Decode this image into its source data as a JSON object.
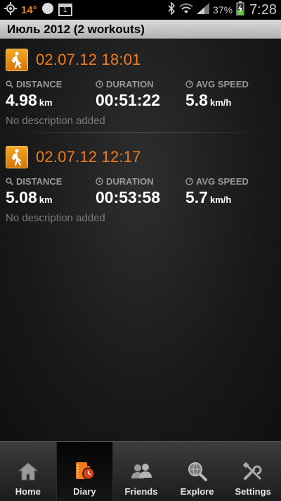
{
  "status_bar": {
    "temperature": "14°",
    "notification_count": "1",
    "battery_percent": "37%",
    "time": "7:28",
    "icons": [
      "gps-icon",
      "circle-icon",
      "calendar-icon",
      "bluetooth-icon",
      "wifi-icon",
      "signal-icon",
      "battery-charging-icon"
    ]
  },
  "header": {
    "title": "Июль 2012 (2 workouts)"
  },
  "workouts": [
    {
      "datetime": "02.07.12 18:01",
      "distance_label": "DISTANCE",
      "distance_value": "4.98",
      "distance_unit": "km",
      "duration_label": "DURATION",
      "duration_value": "00:51:22",
      "speed_label": "AVG SPEED",
      "speed_value": "5.8",
      "speed_unit": "km/h",
      "description": "No description added",
      "icon": "walking-icon"
    },
    {
      "datetime": "02.07.12 12:17",
      "distance_label": "DISTANCE",
      "distance_value": "5.08",
      "distance_unit": "km",
      "duration_label": "DURATION",
      "duration_value": "00:53:58",
      "speed_label": "AVG SPEED",
      "speed_value": "5.7",
      "speed_unit": "km/h",
      "description": "No description added",
      "icon": "walking-icon"
    }
  ],
  "tabs": [
    {
      "label": "Home",
      "icon": "house-icon",
      "active": false
    },
    {
      "label": "Diary",
      "icon": "diary-stopwatch-icon",
      "active": true
    },
    {
      "label": "Friends",
      "icon": "friends-icon",
      "active": false
    },
    {
      "label": "Explore",
      "icon": "globe-search-icon",
      "active": false
    },
    {
      "label": "Settings",
      "icon": "tools-icon",
      "active": false
    }
  ],
  "colors": {
    "accent": "#f07c1a",
    "label_gray": "#9a9a9a",
    "desc_gray": "#7c7c7c"
  }
}
